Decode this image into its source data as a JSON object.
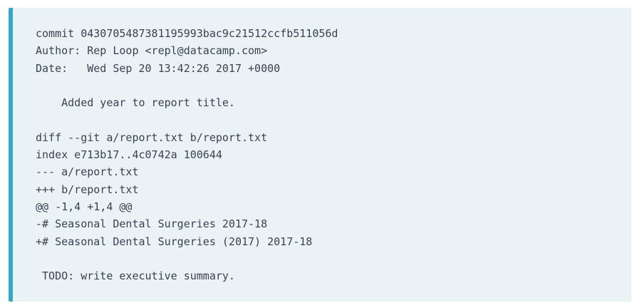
{
  "code": {
    "lines": [
      "commit 0430705487381195993bac9c21512ccfb511056d",
      "Author: Rep Loop <repl@datacamp.com>",
      "Date:   Wed Sep 20 13:42:26 2017 +0000",
      "",
      "    Added year to report title.",
      "",
      "diff --git a/report.txt b/report.txt",
      "index e713b17..4c0742a 100644",
      "--- a/report.txt",
      "+++ b/report.txt",
      "@@ -1,4 +1,4 @@",
      "-# Seasonal Dental Surgeries 2017-18",
      "+# Seasonal Dental Surgeries (2017) 2017-18",
      "",
      " TODO: write executive summary."
    ]
  },
  "colors": {
    "background": "#e9f3f6",
    "accent_border": "#36a9c6",
    "text": "#3a4250"
  }
}
